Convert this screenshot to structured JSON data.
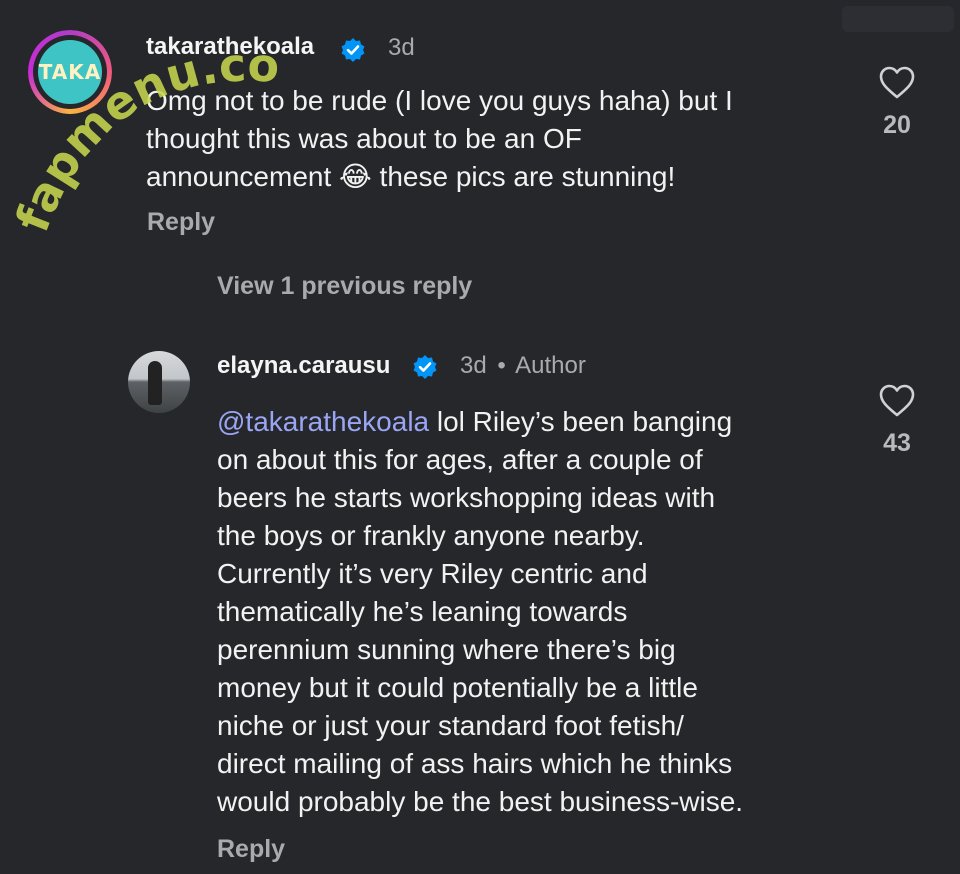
{
  "watermark": "fapmenu.com",
  "comments": [
    {
      "username": "takarathekoala",
      "avatar_text": "TAKA",
      "verified": true,
      "time": "3d",
      "text_lines": [
        "Omg not to be rude (I love you guys haha) but I",
        "thought this was about to be an OF",
        "announcement",
        "these pics are stunning!"
      ],
      "emoji": "😂",
      "reply_label": "Reply",
      "likes": "20"
    },
    {
      "username": "elayna.carausu",
      "verified": true,
      "time": "3d",
      "author_sep": "•",
      "author_label": "Author",
      "mention": "@takarathekoala",
      "text_lines": [
        "lol Riley’s been banging",
        "on about this for ages, after a couple of",
        "beers he starts workshopping ideas with",
        "the boys or frankly anyone nearby.",
        "Currently it’s very Riley centric and",
        "thematically he’s leaning towards",
        "perennium sunning where there’s big",
        "money but it could potentially be a little",
        "niche or just your standard foot fetish/",
        "direct mailing of ass hairs which he thinks",
        "would probably be the best business-wise."
      ],
      "reply_label": "Reply",
      "likes": "43"
    }
  ],
  "view_previous": "View 1 previous reply",
  "colors": {
    "background": "#25272b",
    "verified": "#0095f6",
    "mention": "#9aa6f4"
  }
}
